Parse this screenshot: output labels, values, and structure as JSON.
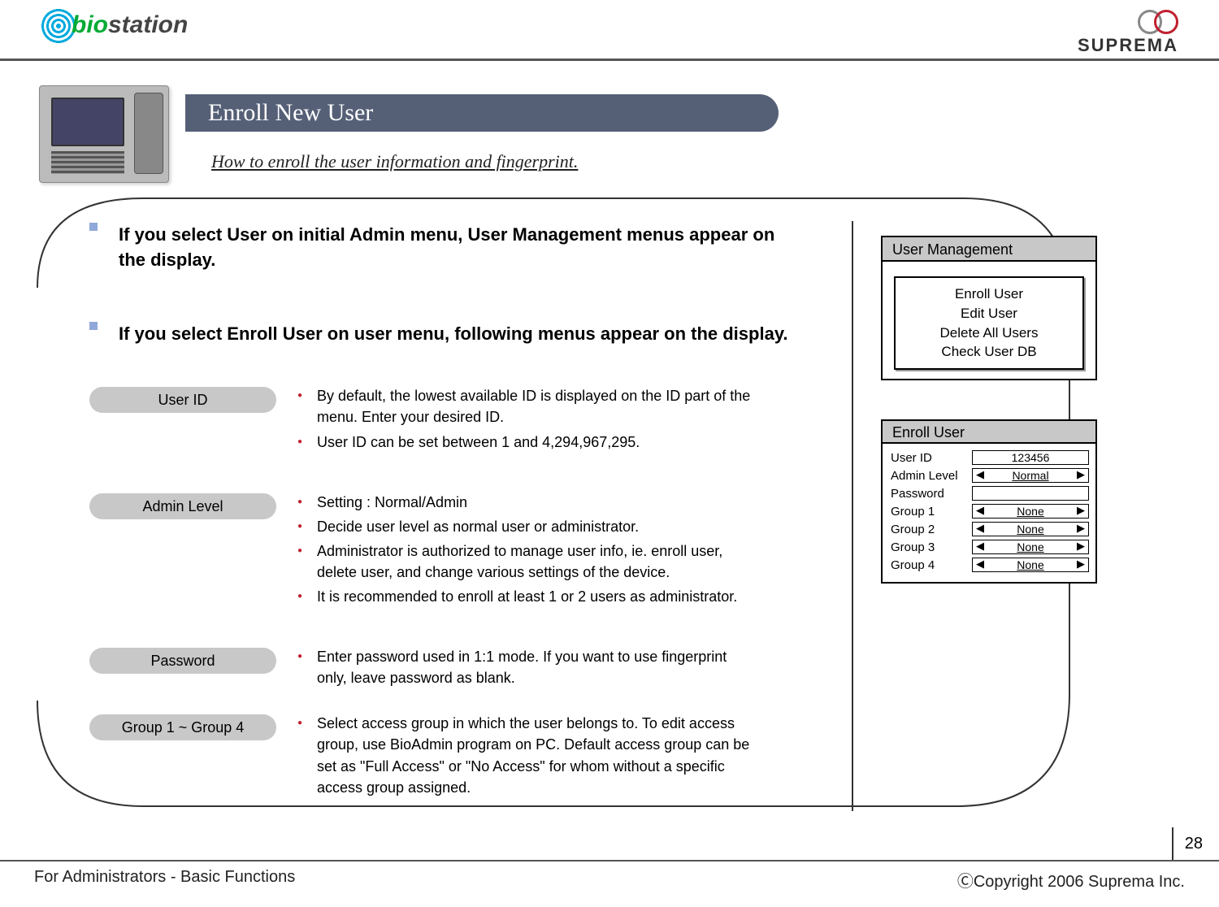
{
  "header": {
    "logo_left_text": "biostation",
    "logo_right_text": "SUPREMA"
  },
  "title": "Enroll New User",
  "subtitle": "How to enroll the user information and fingerprint.",
  "intro": [
    "If you select User on initial Admin menu, User Management menus appear on the display.",
    "If you select Enroll User on user menu, following menus appear on the display."
  ],
  "options": [
    {
      "label": "User ID",
      "bullets": [
        "By default, the lowest available ID is displayed on the ID part of the menu. Enter your desired ID.",
        "User ID can be set between 1 and 4,294,967,295."
      ]
    },
    {
      "label": "Admin Level",
      "bullets": [
        "Setting : Normal/Admin",
        "Decide user level as normal user or administrator.",
        "Administrator is authorized to manage user info, ie. enroll user, delete user, and change various settings of the device.",
        "It is recommended to enroll at least 1 or 2 users as administrator."
      ]
    },
    {
      "label": "Password",
      "bullets": [
        "Enter password used in 1:1 mode. If you want to use fingerprint only, leave password as blank."
      ]
    },
    {
      "label": "Group 1 ~ Group 4",
      "bullets": [
        "Select access group in which the user belongs to. To edit access group, use BioAdmin program on PC. Default access group can be set as \"Full Access\" or \"No Access\" for whom without a specific access group assigned."
      ]
    }
  ],
  "menus": {
    "user_mgmt": {
      "title": "User Management",
      "items": [
        "Enroll User",
        "Edit User",
        "Delete All Users",
        "Check User DB"
      ]
    },
    "enroll_user": {
      "title": "Enroll User",
      "fields": [
        {
          "label": "User ID",
          "value": "123456",
          "selector": false
        },
        {
          "label": "Admin Level",
          "value": "Normal",
          "selector": true,
          "underline": true
        },
        {
          "label": "Password",
          "value": "",
          "selector": false
        },
        {
          "label": "Group 1",
          "value": "None",
          "selector": true,
          "underline": true
        },
        {
          "label": "Group 2",
          "value": "None",
          "selector": true,
          "underline": true
        },
        {
          "label": "Group 3",
          "value": "None",
          "selector": true,
          "underline": true
        },
        {
          "label": "Group 4",
          "value": "None",
          "selector": true,
          "underline": true
        }
      ]
    }
  },
  "footer": {
    "left": "For Administrators - Basic Functions",
    "right": "ⒸCopyright 2006 Suprema Inc.",
    "page_number": "28"
  }
}
